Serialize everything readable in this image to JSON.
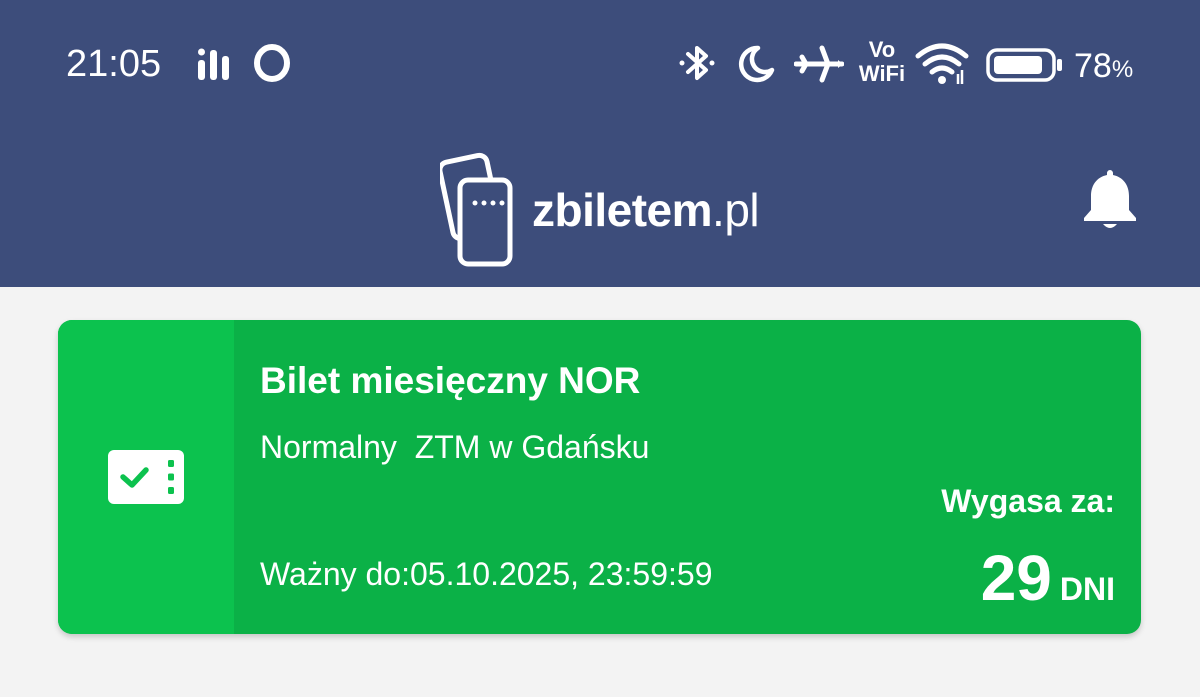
{
  "status_bar": {
    "time": "21:05",
    "battery_percent": "78",
    "battery_percent_sign": "%",
    "volte_top": "Vo",
    "volte_bottom": "WiFi",
    "icons": [
      "activity-bars-icon",
      "opera-icon",
      "bluetooth-icon",
      "moon-icon",
      "airplane-icon",
      "vowifi-icon",
      "wifi-icon",
      "battery-icon"
    ]
  },
  "app_bar": {
    "logo_text_bold": "zbiletem",
    "logo_text_suffix": ".pl",
    "notification_icon": "bell-icon"
  },
  "ticket": {
    "name": "Bilet miesięczny NOR",
    "type": "Normalny  ZTM w Gdańsku",
    "valid_until": "Ważny do:05.10.2025, 23:59:59",
    "expires_label": "Wygasa za:",
    "expires_days": "29",
    "expires_unit": "DNI",
    "icon": "ticket-check-icon"
  },
  "colors": {
    "header_bg": "#3d4d7b",
    "card_bg": "#0bb147",
    "card_left_bg": "#0cc24e",
    "page_bg": "#f3f3f3"
  }
}
